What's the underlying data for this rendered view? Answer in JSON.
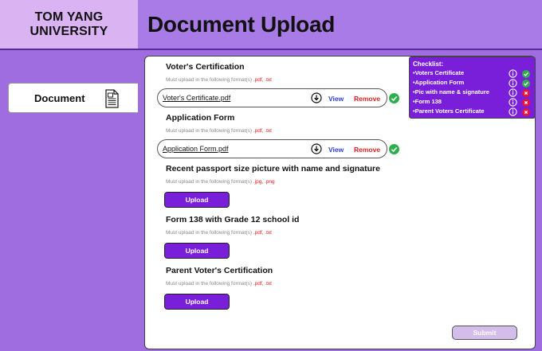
{
  "header": {
    "brand_line1": "TOM YANG",
    "brand_line2": "UNIVERSITY",
    "page_title": "Document Upload"
  },
  "sidebar": {
    "items": [
      {
        "label": "Document",
        "icon": "document-icon"
      }
    ]
  },
  "sections": [
    {
      "title": "Voter's Certification",
      "hint_prefix": "Must upload in the following format(s)",
      "formats": ".pdf, .txt",
      "file": {
        "name": "Voter's Certificate.pdf",
        "view": "View",
        "remove": "Remove",
        "uploaded": true
      }
    },
    {
      "title": "Application Form",
      "hint_prefix": "Must upload in the following format(s)",
      "formats": ".pdf, .txt",
      "file": {
        "name": "Application Form.pdf",
        "view": "View",
        "remove": "Remove",
        "uploaded": true
      }
    },
    {
      "title": "Recent passport size picture with name and signature",
      "hint_prefix": "Must upload in the following format(s)",
      "formats": ".jpg, .png",
      "upload_label": "Upload"
    },
    {
      "title": "Form 138 with Grade 12 school id",
      "hint_prefix": "Must upload in the following format(s)",
      "formats": ".pdf, .txt",
      "upload_label": "Upload"
    },
    {
      "title": "Parent Voter's Certification",
      "hint_prefix": "Must upload in the following format(s)",
      "formats": ".pdf, .txt",
      "upload_label": "Upload"
    }
  ],
  "checklist": {
    "title": "Checklist:",
    "items": [
      {
        "label": "•Voters Certificate",
        "status": "complete"
      },
      {
        "label": "•Application Form",
        "status": "complete"
      },
      {
        "label": "•Pic with name & signature",
        "status": "missing"
      },
      {
        "label": "•Form 138",
        "status": "missing"
      },
      {
        "label": "•Parent Voters Certificate",
        "status": "missing"
      }
    ]
  },
  "submit_label": "Submit",
  "colors": {
    "brand_bg": "#d9b3f2",
    "title_bg": "#a97be6",
    "sidebar_bg": "#a06de0",
    "accent": "#7a1fd9",
    "format_text": "#e02020",
    "view_link": "#2a3bd8",
    "remove_link": "#e02020",
    "complete": "#2fae4e",
    "missing": "#e8133a",
    "submit_disabled": "#d4bde8"
  }
}
